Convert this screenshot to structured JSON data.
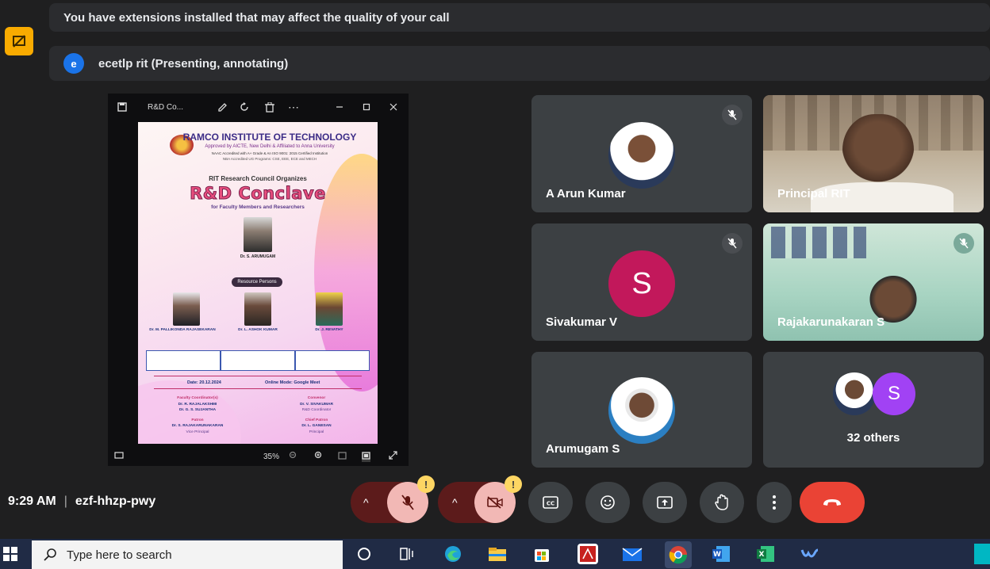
{
  "banner": {
    "text": "You have extensions installed that may affect the quality of your call"
  },
  "presenter": {
    "initial": "e",
    "text": "ecetlp rit (Presenting, annotating)"
  },
  "viewer": {
    "title": "R&D Co...",
    "zoom": "35%",
    "poster": {
      "institute": "RAMCO INSTITUTE OF TECHNOLOGY",
      "approval": "Approved by AICTE, New Delhi & Affiliated to Anna University",
      "naac": "NAAC Accredited with A+ Grade & An ISO 9001: 2015 Certified Institution",
      "nba": "NBA Accredited UG Programs: CSE, EEE, ECE and MECH",
      "organizes": "RIT Research Council Organizes",
      "event": "R&D Conclave",
      "audience": "for Faculty Members and Researchers",
      "main_speaker": "Dr. S. ARUMUGAM",
      "resource_persons": "Resource Persons",
      "speaker1": "Dr. M. PALLIKONDA RAJASEKARAN",
      "speaker2": "Dr. L. ASHOK KUMAR",
      "speaker3": "Dr. J. REVATHY",
      "date": "Date: 20.12.2024",
      "mode": "Online Mode: Google Meet",
      "coord_title": "Faculty Coordinator(s)",
      "coord1": "Dr. R. RAJALAKSHMI",
      "coord2": "Dr. G. S. SUJANTHA",
      "convenor_title": "Convenor",
      "convenor": "Dr. V. SIVAKUMAR",
      "convenor_role": "R&D Coordinator",
      "patron_title": "Patron",
      "patron": "Dr. S. RAJAKARUNAKARAN",
      "patron_role": "Vice Principal",
      "chief_patron_title": "Chief Patron",
      "chief_patron": "Dr. L. GANESAN",
      "chief_patron_role": "Principal"
    }
  },
  "participants": [
    {
      "name": "A Arun Kumar"
    },
    {
      "name": "Principal RIT"
    },
    {
      "name": "Sivakumar V",
      "initial": "S"
    },
    {
      "name": "Rajakarunakaran S"
    },
    {
      "name": "Arumugam S"
    },
    {
      "name": "32 others",
      "initial": "S"
    }
  ],
  "meeting": {
    "time": "9:29 AM",
    "separator": "|",
    "code": "ezf-hhzp-pwy"
  },
  "warning_badge": "!",
  "taskbar": {
    "search_placeholder": "Type here to search"
  },
  "colors": {
    "accent": "#1a73e8",
    "hangup": "#ea4335",
    "muted_bg": "#f2b8b5",
    "warning": "#fdd663",
    "avatar_pink": "#c2185b",
    "avatar_purple": "#a142f4"
  }
}
